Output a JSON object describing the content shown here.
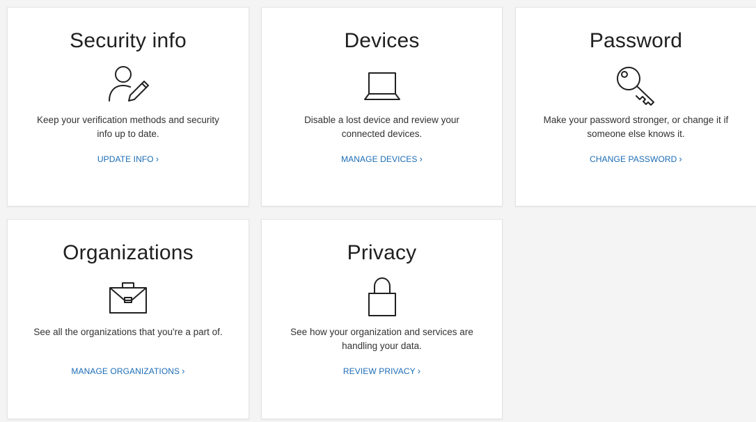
{
  "cards": [
    {
      "title": "Security info",
      "icon": "person-edit-icon",
      "description": "Keep your verification methods and security info up to date.",
      "link_label": "UPDATE INFO"
    },
    {
      "title": "Devices",
      "icon": "laptop-icon",
      "description": "Disable a lost device and review your connected devices.",
      "link_label": "MANAGE DEVICES"
    },
    {
      "title": "Password",
      "icon": "key-icon",
      "description": "Make your password stronger, or change it if someone else knows it.",
      "link_label": "CHANGE PASSWORD"
    },
    {
      "title": "Organizations",
      "icon": "briefcase-icon",
      "description": "See all the organizations that you're a part of.",
      "link_label": "MANAGE ORGANIZATIONS"
    },
    {
      "title": "Privacy",
      "icon": "lock-icon",
      "description": "See how your organization and services are handling your data.",
      "link_label": "REVIEW PRIVACY"
    }
  ],
  "colors": {
    "link": "#1b6cb5",
    "title": "#202020",
    "background": "#f4f4f4",
    "card": "#ffffff"
  }
}
